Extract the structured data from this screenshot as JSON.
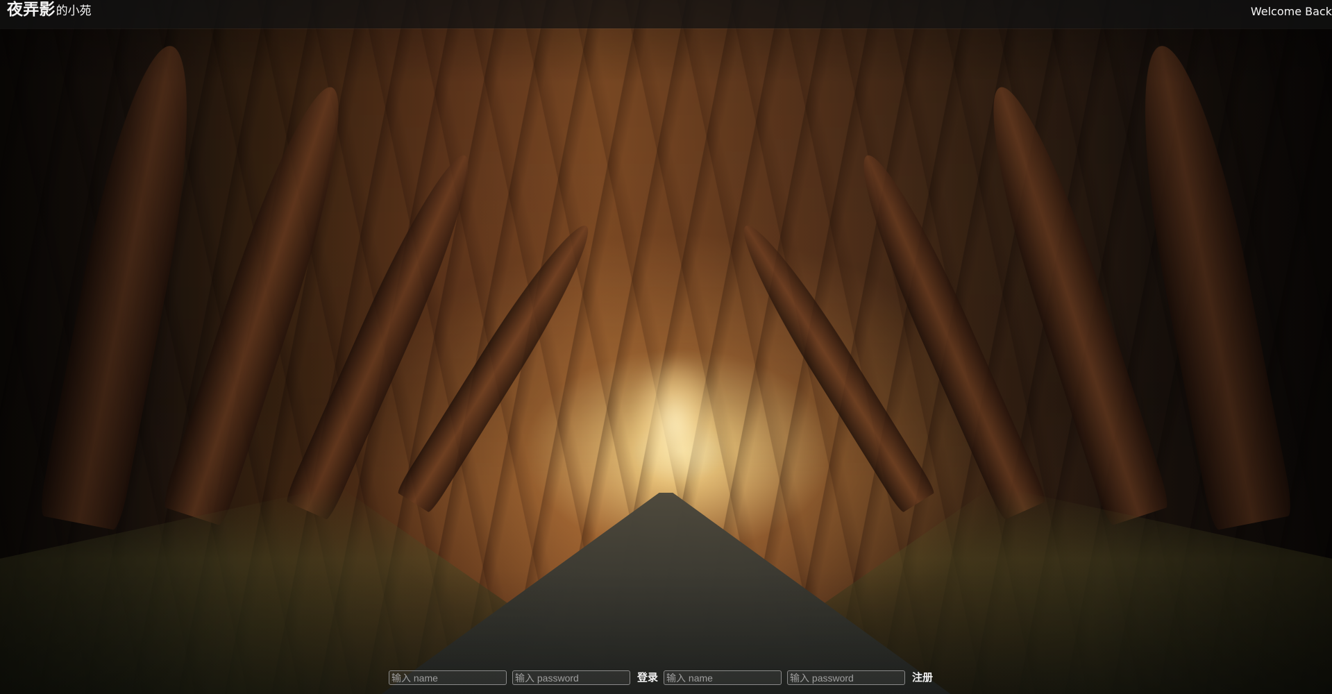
{
  "header": {
    "title_main": "夜弄影",
    "title_sub": "的小苑",
    "welcome_text": "Welcome Back"
  },
  "auth": {
    "login": {
      "name_placeholder": "输入 name",
      "password_placeholder": "输入 password",
      "action_label": "登录"
    },
    "register": {
      "name_placeholder": "输入 name",
      "password_placeholder": "输入 password",
      "action_label": "注册"
    }
  },
  "colors": {
    "topbar": "#141414",
    "text": "#f3f3f3",
    "input_border": "#8a8a8a"
  }
}
